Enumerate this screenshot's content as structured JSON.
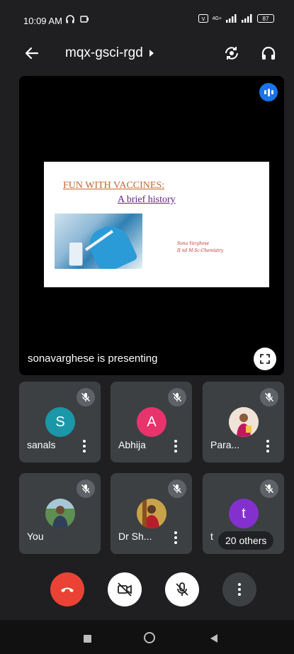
{
  "status_bar": {
    "time": "10:09 AM",
    "network": "4G+",
    "battery": "87"
  },
  "top_bar": {
    "meeting_code": "mqx-gsci-rgd"
  },
  "presentation": {
    "slide": {
      "title": "FUN WITH VACCINES:",
      "subtitle": "A brief history",
      "author": "Sona Varghese",
      "author_detail": "II nd M.Sc-Chemistry"
    },
    "presenting_text": "sonavarghese is presenting"
  },
  "participants": [
    {
      "name": "sanals",
      "initial": "S",
      "avatar_color": "#1a98a8"
    },
    {
      "name": "Abhija",
      "initial": "A",
      "avatar_color": "#e8336d"
    },
    {
      "name": "Para..."
    },
    {
      "name": "You"
    },
    {
      "name": "Dr Sh..."
    },
    {
      "name": "t",
      "initial": "t",
      "avatar_color": "#8430ce",
      "others": "20 others"
    }
  ],
  "colors": {
    "end_call": "#ea4335",
    "background": "#1f1f21",
    "tile": "#3c4043"
  }
}
